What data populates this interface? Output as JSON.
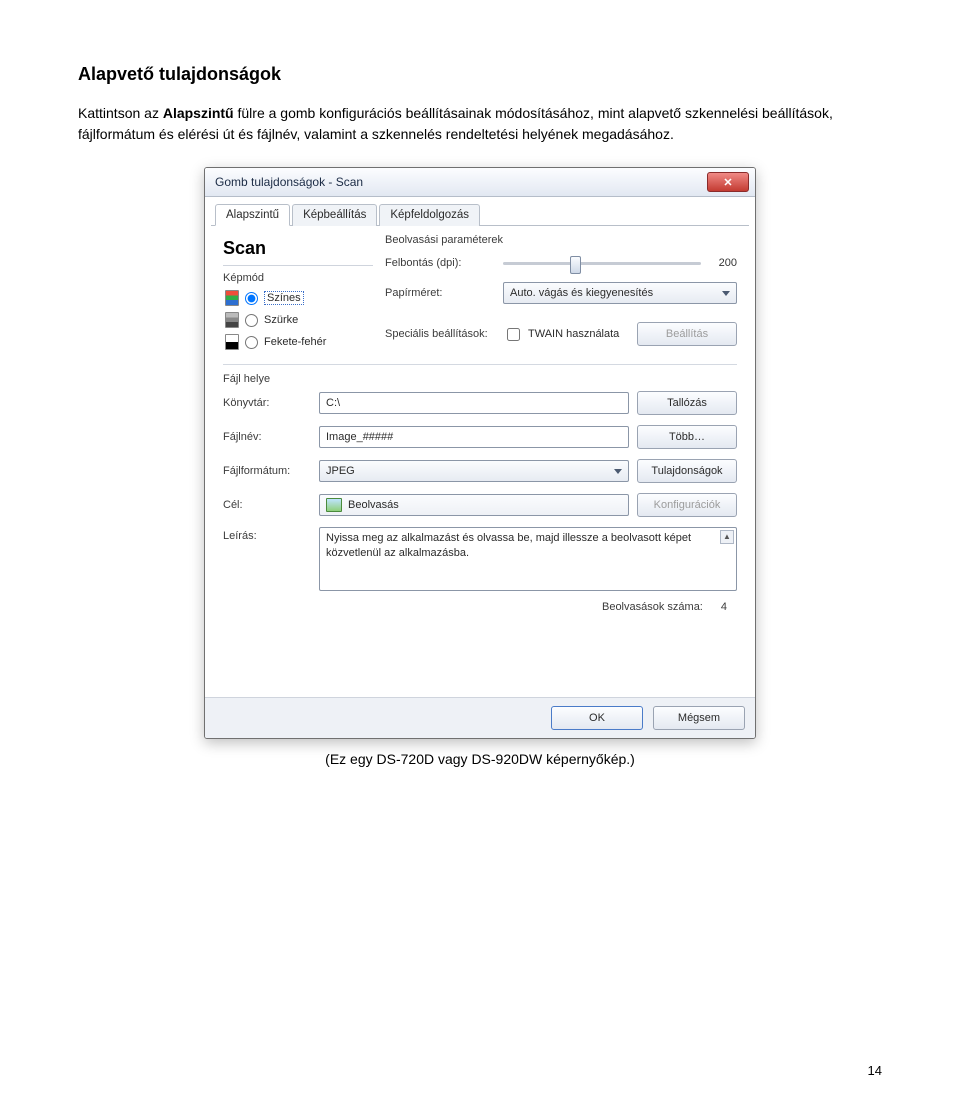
{
  "doc": {
    "heading": "Alapvető tulajdonságok",
    "intro_before": "Kattintson az ",
    "intro_bold": "Alapszintű",
    "intro_after": " fülre a gomb konfigurációs beállításainak módosításához, mint alapvető szkennelési beállítások, fájlformátum és elérési út és fájlnév, valamint a szkennelés rendeltetési helyének megadásához.",
    "caption": "(Ez egy DS-720D vagy DS-920DW képernyőkép.)",
    "page_number": "14"
  },
  "dialog": {
    "title": "Gomb tulajdonságok - Scan",
    "tabs": {
      "t1": "Alapszintű",
      "t2": "Képbeállítás",
      "t3": "Képfeldolgozás"
    },
    "profile_name": "Scan",
    "left": {
      "section": "Képmód",
      "mode_color": "Színes",
      "mode_gray": "Szürke",
      "mode_bw": "Fekete-fehér"
    },
    "params": {
      "section": "Beolvasási paraméterek",
      "resolution_label": "Felbontás (dpi):",
      "resolution_value": "200",
      "paper_label": "Papírméret:",
      "paper_value": "Auto. vágás és kiegyenesítés",
      "special_label": "Speciális beállítások:",
      "twain_label": "TWAIN használata",
      "settings_btn": "Beállítás"
    },
    "file": {
      "section": "Fájl helye",
      "dir_label": "Könyvtár:",
      "dir_value": "C:\\",
      "browse_btn": "Tallózás",
      "name_label": "Fájlnév:",
      "name_value": "Image_#####",
      "more_btn": "Több…",
      "format_label": "Fájlformátum:",
      "format_value": "JPEG",
      "props_btn": "Tulajdonságok",
      "dest_label": "Cél:",
      "dest_value": "Beolvasás",
      "config_btn": "Konfigurációk",
      "desc_label": "Leírás:",
      "desc_value": "Nyissa meg az alkalmazást és olvassa be, majd illessze a beolvasott képet közvetlenül az alkalmazásba.",
      "count_label": "Beolvasások száma:",
      "count_value": "4"
    },
    "footer": {
      "ok": "OK",
      "cancel": "Mégsem"
    }
  }
}
